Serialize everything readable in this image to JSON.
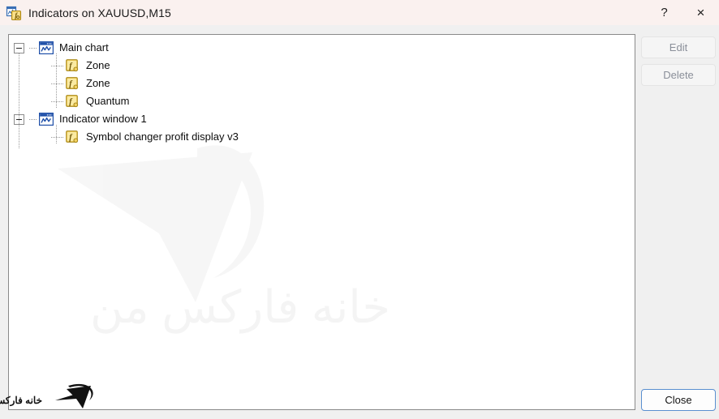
{
  "window": {
    "title": "Indicators on XAUUSD,M15",
    "icon": "indicators-window-icon",
    "help_label": "?",
    "close_label": "×"
  },
  "tree": {
    "nodes": [
      {
        "label": "Main chart",
        "icon": "chart-window-icon",
        "expanded": true,
        "children": [
          {
            "label": "Zone",
            "icon": "fx-indicator-icon"
          },
          {
            "label": "Zone",
            "icon": "fx-indicator-icon"
          },
          {
            "label": "Quantum",
            "icon": "fx-indicator-icon"
          }
        ]
      },
      {
        "label": "Indicator window 1",
        "icon": "chart-window-icon",
        "expanded": true,
        "children": [
          {
            "label": "Symbol changer profit display v3",
            "icon": "fx-indicator-icon"
          }
        ]
      }
    ]
  },
  "buttons": {
    "edit": "Edit",
    "delete": "Delete",
    "close": "Close"
  },
  "watermark": {
    "text": "خانه فارکس من"
  },
  "brand": {
    "text": "خانه فارکس من"
  },
  "colors": {
    "titlebar_bg": "#faf1ef",
    "dialog_bg": "#f0f0f0",
    "panel_bg": "#ffffff",
    "panel_border": "#898989",
    "accent_blue": "#2255aa",
    "fx_gold": "#f0c93c",
    "default_button_border": "#5a8fd0",
    "disabled_text": "#8a8f99"
  }
}
